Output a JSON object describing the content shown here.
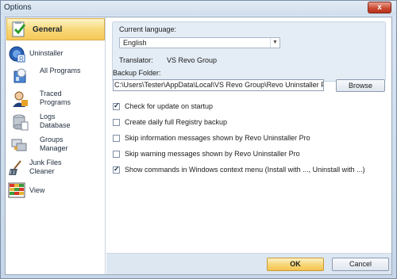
{
  "window": {
    "title": "Options",
    "close_label": "x"
  },
  "sidebar": {
    "items": [
      {
        "label": "General",
        "icon": "general-check-icon",
        "selected": true
      },
      {
        "label": "Uninstaller",
        "icon": "uninstaller-disc-icon"
      },
      {
        "label": "All Programs",
        "icon": "all-programs-icon"
      },
      {
        "label": "Traced Programs",
        "icon": "traced-programs-user-icon"
      },
      {
        "label": "Logs Database",
        "icon": "logs-database-icon"
      },
      {
        "label": "Groups Manager",
        "icon": "groups-manager-icon"
      },
      {
        "label": "Junk Files Cleaner",
        "icon": "junk-cleaner-broom-icon"
      },
      {
        "label": "View",
        "icon": "view-grid-icon"
      }
    ]
  },
  "general": {
    "language_label": "Current language:",
    "language_value": "English",
    "translator_label": "Translator:",
    "translator_value": "VS Revo Group",
    "backup_label": "Backup Folder:",
    "backup_path": "C:\\Users\\Tester\\AppData\\Local\\VS Revo Group\\Revo Uninstaller Pro\\BackUp",
    "browse_label": "Browse",
    "options": [
      {
        "label": "Check for update on startup",
        "checked": true
      },
      {
        "label": "Create daily full Registry backup",
        "checked": false
      },
      {
        "label": "Skip information messages shown by Revo Uninstaller Pro",
        "checked": false
      },
      {
        "label": "Skip warning messages shown by Revo Uninstaller Pro",
        "checked": false
      },
      {
        "label": "Show commands in Windows context menu (Install with ..., Uninstall with ...)",
        "checked": true
      }
    ]
  },
  "footer": {
    "ok_label": "OK",
    "cancel_label": "Cancel"
  },
  "colors": {
    "accent_selected": "#f8d879",
    "panel_blue": "#e4ecf5"
  },
  "glyphs": {
    "check": "✓",
    "dropdown": "▼"
  }
}
